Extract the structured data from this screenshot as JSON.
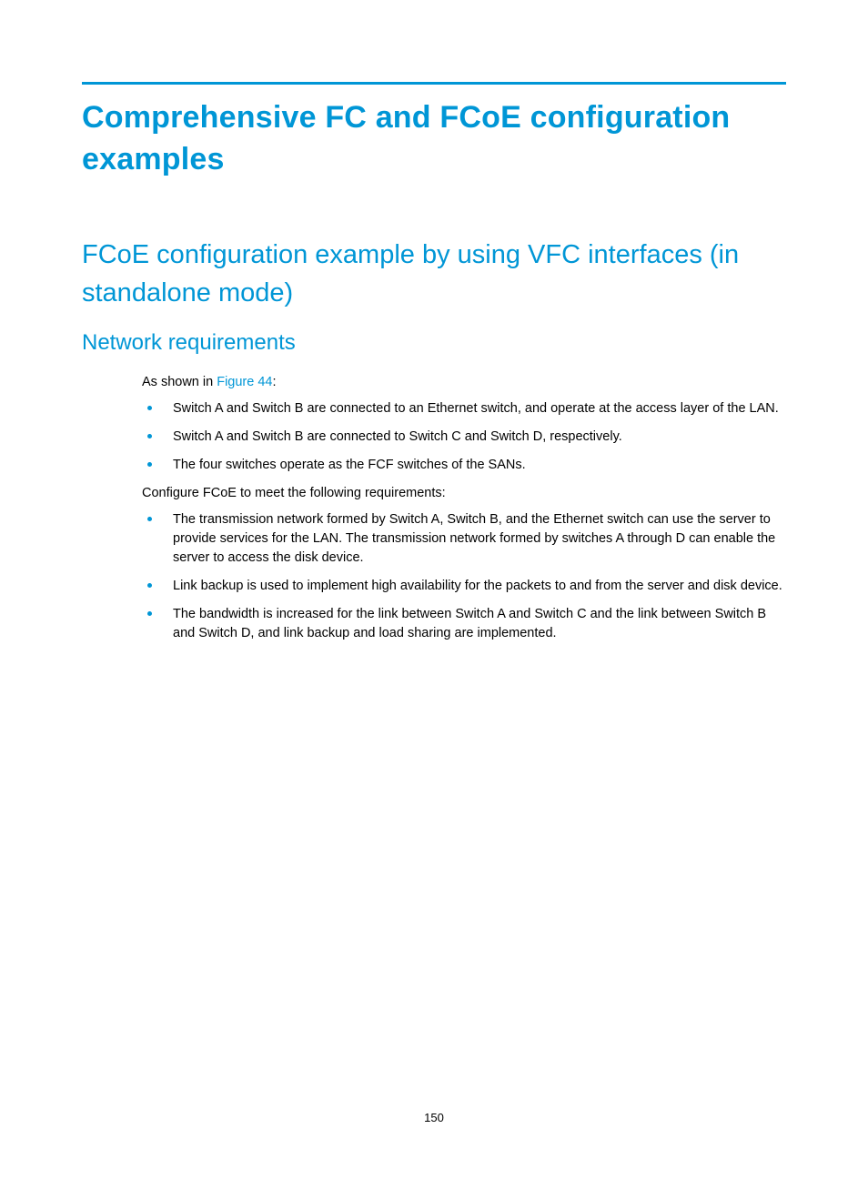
{
  "headings": {
    "h1": "Comprehensive FC and FCoE configuration examples",
    "h2": "FCoE configuration example by using VFC interfaces (in standalone mode)",
    "h3": "Network requirements"
  },
  "intro": {
    "prefix": "As shown in ",
    "link": "Figure 44",
    "suffix": ":"
  },
  "bullets1": [
    "Switch A and Switch B are connected to an Ethernet switch, and operate at the access layer of the LAN.",
    "Switch A and Switch B are connected to Switch C and Switch D, respectively.",
    "The four switches operate as the FCF switches of the SANs."
  ],
  "para2": "Configure FCoE to meet the following requirements:",
  "bullets2": [
    "The transmission network formed by Switch A, Switch B, and the Ethernet switch can use the server to provide services for the LAN. The transmission network formed by switches A through D can enable the server to access the disk device.",
    "Link backup is used to implement high availability for the packets to and from the server and disk device.",
    "The bandwidth is increased for the link between Switch A and Switch C and the link between Switch B and Switch D, and link backup and load sharing are implemented."
  ],
  "pageNumber": "150"
}
